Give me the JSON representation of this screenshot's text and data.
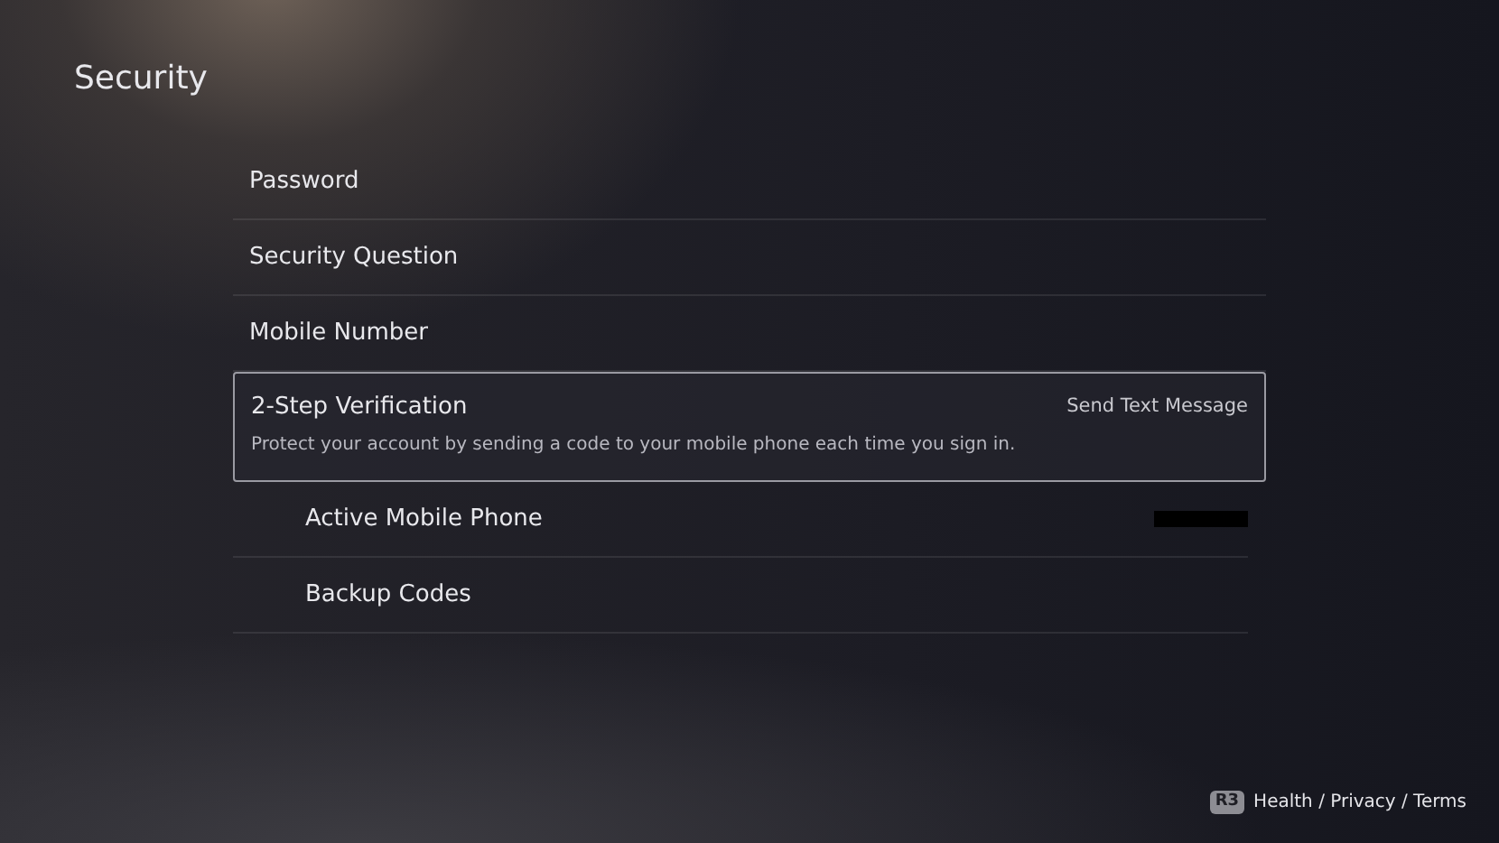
{
  "title": "Security",
  "items": [
    {
      "label": "Password",
      "selected": false
    },
    {
      "label": "Security Question",
      "selected": false
    },
    {
      "label": "Mobile Number",
      "selected": false
    },
    {
      "label": "2-Step Verification",
      "value": "Send Text Message",
      "description": "Protect your account by sending a code to your mobile phone each time you sign in.",
      "selected": true,
      "children": [
        {
          "label": "Active Mobile Phone",
          "redacted": true
        },
        {
          "label": "Backup Codes",
          "redacted": false
        }
      ]
    }
  ],
  "footer": {
    "button": "R3",
    "link": "Health / Privacy / Terms"
  }
}
